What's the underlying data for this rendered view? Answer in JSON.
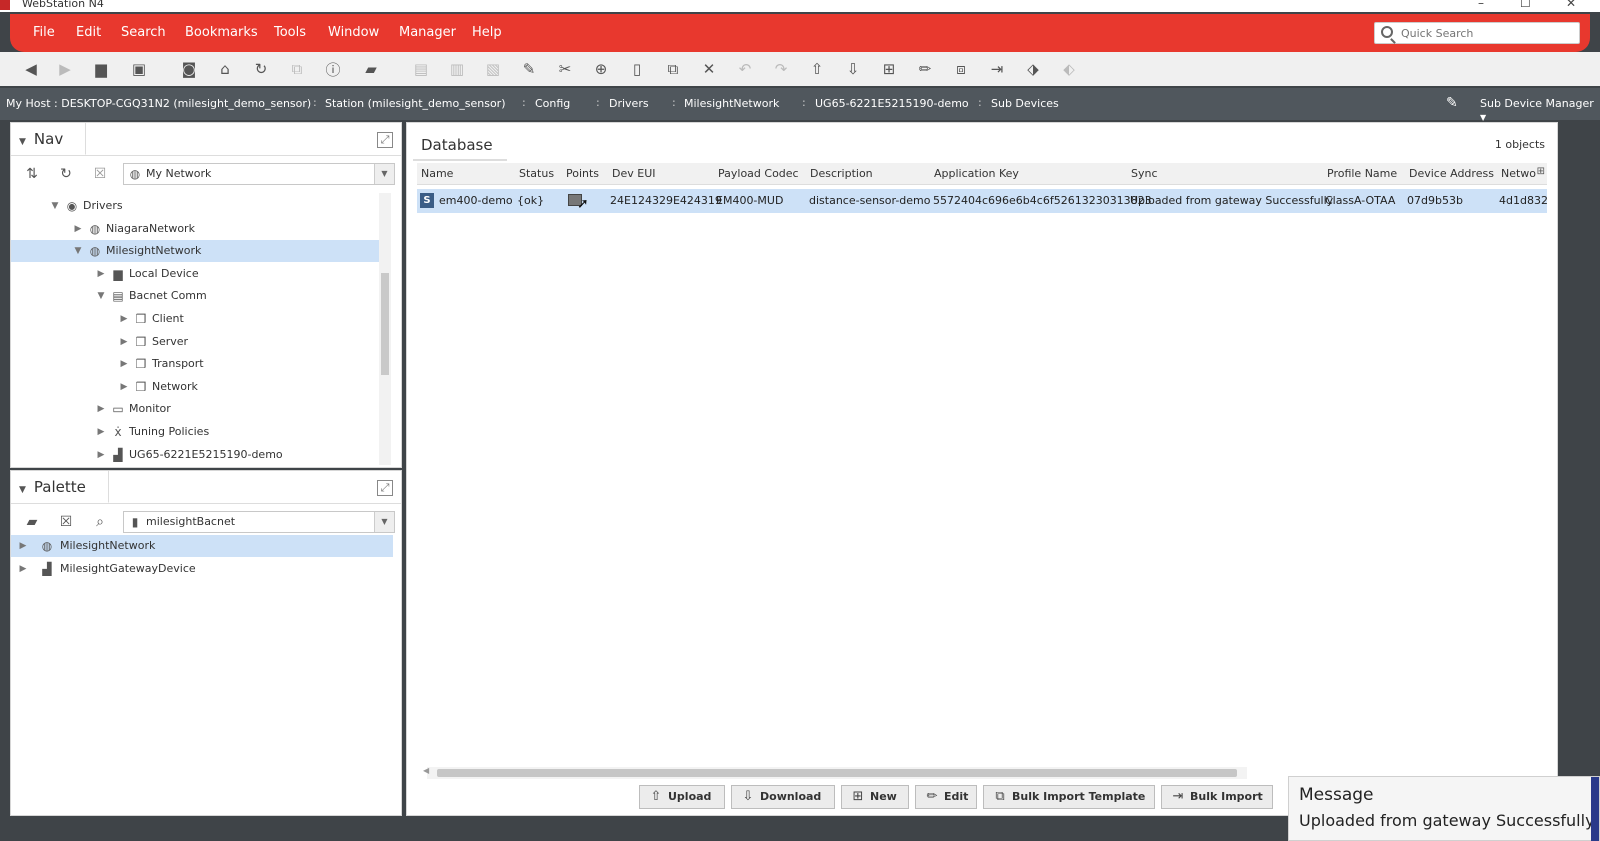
{
  "window": {
    "title": "WebStation N4",
    "controls": [
      "–",
      "☐",
      "✕"
    ]
  },
  "menu": {
    "items": [
      "File",
      "Edit",
      "Search",
      "Bookmarks",
      "Tools",
      "Window",
      "Manager",
      "Help"
    ]
  },
  "quick_search": {
    "placeholder": "Quick Search"
  },
  "toolbar": {
    "buttons": [
      "back",
      "forward",
      "up-level",
      "side-bar",
      "home",
      "refresh",
      "hyperlink-disabled",
      "info",
      "open-folder",
      "save-disabled",
      "save-all-disabled",
      "export-disabled",
      "new-doc",
      "cut",
      "copy",
      "paste",
      "duplicate",
      "delete",
      "undo-disabled",
      "redo-disabled",
      "upload",
      "download",
      "import",
      "edit",
      "link",
      "export",
      "tag",
      "tag-disabled"
    ]
  },
  "breadcrumb": {
    "items": [
      "My Host : DESKTOP-CGQ31N2 (milesight_demo_sensor)",
      "Station (milesight_demo_sensor)",
      "Config",
      "Drivers",
      "MilesightNetwork",
      "UG65-6221E5215190-demo",
      "Sub Devices"
    ],
    "view_selector": "Sub Device Manager"
  },
  "nav": {
    "title": "Nav",
    "root_combo": "My Network",
    "tree": [
      {
        "label": "Drivers",
        "level": 0,
        "expanded": true,
        "icon": "drivers-icon"
      },
      {
        "label": "NiagaraNetwork",
        "level": 1,
        "expanded": false,
        "icon": "network-icon"
      },
      {
        "label": "MilesightNetwork",
        "level": 1,
        "expanded": true,
        "icon": "network-icon",
        "selected": true
      },
      {
        "label": "Local Device",
        "level": 2,
        "expanded": false,
        "icon": "device-icon"
      },
      {
        "label": "Bacnet Comm",
        "level": 2,
        "expanded": true,
        "icon": "comm-icon"
      },
      {
        "label": "Client",
        "level": 3,
        "expanded": false,
        "icon": "folder-icon"
      },
      {
        "label": "Server",
        "level": 3,
        "expanded": false,
        "icon": "folder-icon"
      },
      {
        "label": "Transport",
        "level": 3,
        "expanded": false,
        "icon": "folder-icon"
      },
      {
        "label": "Network",
        "level": 3,
        "expanded": false,
        "icon": "folder-icon"
      },
      {
        "label": "Monitor",
        "level": 2,
        "expanded": false,
        "icon": "monitor-icon"
      },
      {
        "label": "Tuning Policies",
        "level": 2,
        "expanded": false,
        "icon": "tuning-icon"
      },
      {
        "label": "UG65-6221E5215190-demo",
        "level": 2,
        "expanded": false,
        "icon": "gateway-icon"
      }
    ]
  },
  "palette": {
    "title": "Palette",
    "module_combo": "milesightBacnet",
    "items": [
      {
        "label": "MilesightNetwork",
        "selected": true,
        "icon": "network-icon"
      },
      {
        "label": "MilesightGatewayDevice",
        "selected": false,
        "icon": "gateway-icon"
      }
    ]
  },
  "database": {
    "tab": "Database",
    "count": "1 objects",
    "columns": [
      "Name",
      "Status",
      "Points",
      "Dev EUI",
      "Payload Codec",
      "Description",
      "Application Key",
      "Sync",
      "Profile Name",
      "Device Address",
      "Netwo"
    ],
    "rows": [
      {
        "name": "em400-demo",
        "status": "{ok}",
        "dev_eui": "24E124329E424319",
        "payload_codec": "EM400-MUD",
        "description": "distance-sensor-demo",
        "app_key": "5572404c696e6b4c6f52613230313823",
        "sync": "Uploaded from gateway Successfully",
        "profile": "ClassA-OTAA",
        "device_address": "07d9b53b",
        "network": "4d1d832"
      }
    ]
  },
  "actions": [
    "Upload",
    "Download",
    "New",
    "Edit",
    "Bulk Import Template",
    "Bulk Import"
  ],
  "message": {
    "title": "Message",
    "body": "Uploaded from gateway Successfully"
  }
}
